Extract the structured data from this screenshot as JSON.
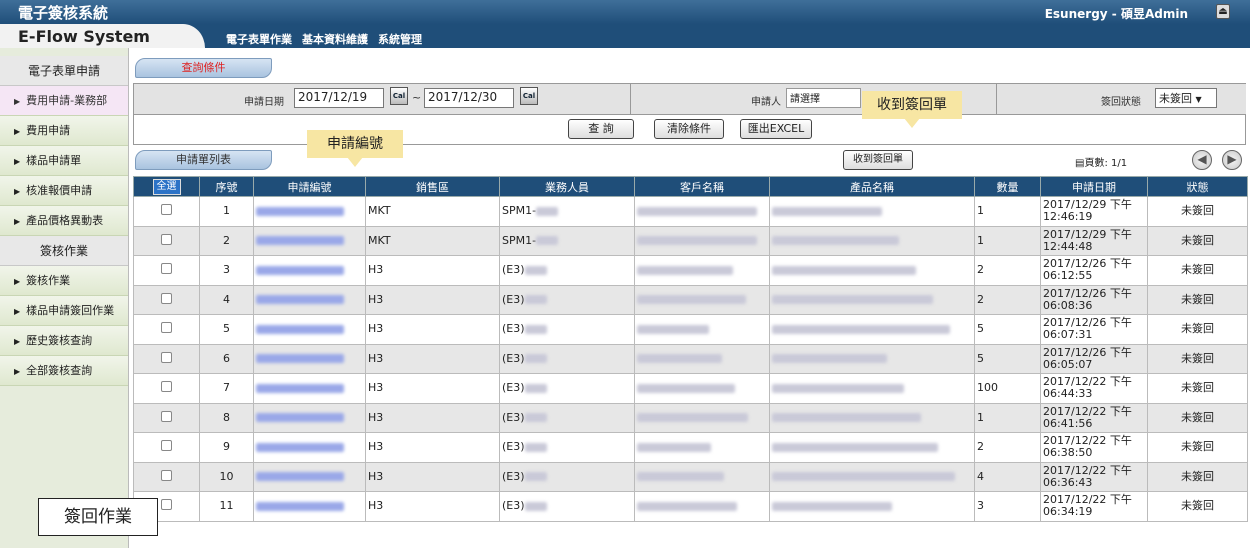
{
  "header": {
    "system_name": "電子簽核系統",
    "user_info": "Esunergy - 碩昱Admin",
    "eflow_title": "E-Flow System",
    "menu": [
      "電子表單作業",
      "基本資料維護",
      "系統管理"
    ]
  },
  "sidebar": {
    "section1_title": "電子表單申請",
    "section1_items": [
      "費用申請-業務部",
      "費用申請",
      "樣品申請單",
      "核准報價申請",
      "產品價格異動表"
    ],
    "section2_title": "簽核作業",
    "section2_items": [
      "簽核作業",
      "樣品申請簽回作業",
      "歷史簽核查詢",
      "全部簽核查詢"
    ]
  },
  "query": {
    "tab_label": "查詢條件",
    "date_label": "申請日期",
    "date_from": "2017/12/19",
    "date_to": "2017/12/30",
    "cal_label": "Cal",
    "range_sep": "~",
    "applicant_label": "申請人",
    "applicant_value": "請選擇",
    "signback_label": "簽回狀態",
    "signback_value": "未簽回",
    "search_button": "查 詢",
    "clear_button": "清除條件",
    "export_button": "匯出EXCEL"
  },
  "list": {
    "tab_label": "申請單列表",
    "receive_button": "收到簽回單",
    "page_info": "頁數: 1/1"
  },
  "callouts": {
    "receive": "收到簽回單",
    "app_no": "申請編號",
    "signback_op": "簽回作業"
  },
  "table": {
    "select_all": "全選",
    "headers": [
      "序號",
      "申請編號",
      "銷售區",
      "業務人員",
      "客戶名稱",
      "產品名稱",
      "數量",
      "申請日期",
      "狀態"
    ],
    "rows": [
      {
        "no": "1",
        "region": "MKT",
        "sales": "SPM1-",
        "qty": "1",
        "date1": "2017/12/29 下午",
        "date2": "12:46:19",
        "status": "未簽回"
      },
      {
        "no": "2",
        "region": "MKT",
        "sales": "SPM1-",
        "qty": "1",
        "date1": "2017/12/29 下午",
        "date2": "12:44:48",
        "status": "未簽回"
      },
      {
        "no": "3",
        "region": "H3",
        "sales": "(E3)",
        "qty": "2",
        "date1": "2017/12/26 下午",
        "date2": "06:12:55",
        "status": "未簽回"
      },
      {
        "no": "4",
        "region": "H3",
        "sales": "(E3)",
        "qty": "2",
        "date1": "2017/12/26 下午",
        "date2": "06:08:36",
        "status": "未簽回"
      },
      {
        "no": "5",
        "region": "H3",
        "sales": "(E3)",
        "qty": "5",
        "date1": "2017/12/26 下午",
        "date2": "06:07:31",
        "status": "未簽回"
      },
      {
        "no": "6",
        "region": "H3",
        "sales": "(E3)",
        "qty": "5",
        "date1": "2017/12/26 下午",
        "date2": "06:05:07",
        "status": "未簽回"
      },
      {
        "no": "7",
        "region": "H3",
        "sales": "(E3)",
        "qty": "100",
        "date1": "2017/12/22 下午",
        "date2": "06:44:33",
        "status": "未簽回"
      },
      {
        "no": "8",
        "region": "H3",
        "sales": "(E3)",
        "qty": "1",
        "date1": "2017/12/22 下午",
        "date2": "06:41:56",
        "status": "未簽回"
      },
      {
        "no": "9",
        "region": "H3",
        "sales": "(E3)",
        "qty": "2",
        "date1": "2017/12/22 下午",
        "date2": "06:38:50",
        "status": "未簽回"
      },
      {
        "no": "10",
        "region": "H3",
        "sales": "(E3)",
        "qty": "4",
        "date1": "2017/12/22 下午",
        "date2": "06:36:43",
        "status": "未簽回"
      },
      {
        "no": "11",
        "region": "H3",
        "sales": "(E3)",
        "qty": "3",
        "date1": "2017/12/22 下午",
        "date2": "06:34:19",
        "status": "未簽回"
      }
    ]
  },
  "colors": {
    "header_blue": "#1f4e79",
    "callout_yellow": "#f7e6a3",
    "sidebar_green": "#e6ecdc"
  }
}
